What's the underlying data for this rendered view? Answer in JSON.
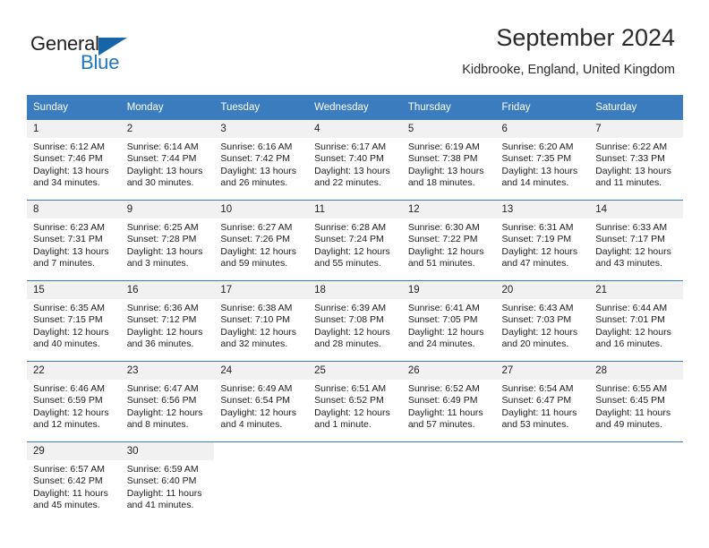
{
  "brand": {
    "name_top": "General",
    "name_bottom": "Blue",
    "colors": {
      "dark": "#231f20",
      "blue": "#1f77c4",
      "triangle": "#1565a8"
    }
  },
  "header": {
    "title": "September 2024",
    "location": "Kidbrooke, England, United Kingdom"
  },
  "theme": {
    "header_bg": "#3a7cbe",
    "daynum_bg": "#f1f1f1",
    "grid_line": "#3a7cbe"
  },
  "weekday_headers": [
    "Sunday",
    "Monday",
    "Tuesday",
    "Wednesday",
    "Thursday",
    "Friday",
    "Saturday"
  ],
  "weeks": [
    [
      {
        "day": "1",
        "sunrise": "Sunrise: 6:12 AM",
        "sunset": "Sunset: 7:46 PM",
        "daylight_1": "Daylight: 13 hours",
        "daylight_2": "and 34 minutes."
      },
      {
        "day": "2",
        "sunrise": "Sunrise: 6:14 AM",
        "sunset": "Sunset: 7:44 PM",
        "daylight_1": "Daylight: 13 hours",
        "daylight_2": "and 30 minutes."
      },
      {
        "day": "3",
        "sunrise": "Sunrise: 6:16 AM",
        "sunset": "Sunset: 7:42 PM",
        "daylight_1": "Daylight: 13 hours",
        "daylight_2": "and 26 minutes."
      },
      {
        "day": "4",
        "sunrise": "Sunrise: 6:17 AM",
        "sunset": "Sunset: 7:40 PM",
        "daylight_1": "Daylight: 13 hours",
        "daylight_2": "and 22 minutes."
      },
      {
        "day": "5",
        "sunrise": "Sunrise: 6:19 AM",
        "sunset": "Sunset: 7:38 PM",
        "daylight_1": "Daylight: 13 hours",
        "daylight_2": "and 18 minutes."
      },
      {
        "day": "6",
        "sunrise": "Sunrise: 6:20 AM",
        "sunset": "Sunset: 7:35 PM",
        "daylight_1": "Daylight: 13 hours",
        "daylight_2": "and 14 minutes."
      },
      {
        "day": "7",
        "sunrise": "Sunrise: 6:22 AM",
        "sunset": "Sunset: 7:33 PM",
        "daylight_1": "Daylight: 13 hours",
        "daylight_2": "and 11 minutes."
      }
    ],
    [
      {
        "day": "8",
        "sunrise": "Sunrise: 6:23 AM",
        "sunset": "Sunset: 7:31 PM",
        "daylight_1": "Daylight: 13 hours",
        "daylight_2": "and 7 minutes."
      },
      {
        "day": "9",
        "sunrise": "Sunrise: 6:25 AM",
        "sunset": "Sunset: 7:28 PM",
        "daylight_1": "Daylight: 13 hours",
        "daylight_2": "and 3 minutes."
      },
      {
        "day": "10",
        "sunrise": "Sunrise: 6:27 AM",
        "sunset": "Sunset: 7:26 PM",
        "daylight_1": "Daylight: 12 hours",
        "daylight_2": "and 59 minutes."
      },
      {
        "day": "11",
        "sunrise": "Sunrise: 6:28 AM",
        "sunset": "Sunset: 7:24 PM",
        "daylight_1": "Daylight: 12 hours",
        "daylight_2": "and 55 minutes."
      },
      {
        "day": "12",
        "sunrise": "Sunrise: 6:30 AM",
        "sunset": "Sunset: 7:22 PM",
        "daylight_1": "Daylight: 12 hours",
        "daylight_2": "and 51 minutes."
      },
      {
        "day": "13",
        "sunrise": "Sunrise: 6:31 AM",
        "sunset": "Sunset: 7:19 PM",
        "daylight_1": "Daylight: 12 hours",
        "daylight_2": "and 47 minutes."
      },
      {
        "day": "14",
        "sunrise": "Sunrise: 6:33 AM",
        "sunset": "Sunset: 7:17 PM",
        "daylight_1": "Daylight: 12 hours",
        "daylight_2": "and 43 minutes."
      }
    ],
    [
      {
        "day": "15",
        "sunrise": "Sunrise: 6:35 AM",
        "sunset": "Sunset: 7:15 PM",
        "daylight_1": "Daylight: 12 hours",
        "daylight_2": "and 40 minutes."
      },
      {
        "day": "16",
        "sunrise": "Sunrise: 6:36 AM",
        "sunset": "Sunset: 7:12 PM",
        "daylight_1": "Daylight: 12 hours",
        "daylight_2": "and 36 minutes."
      },
      {
        "day": "17",
        "sunrise": "Sunrise: 6:38 AM",
        "sunset": "Sunset: 7:10 PM",
        "daylight_1": "Daylight: 12 hours",
        "daylight_2": "and 32 minutes."
      },
      {
        "day": "18",
        "sunrise": "Sunrise: 6:39 AM",
        "sunset": "Sunset: 7:08 PM",
        "daylight_1": "Daylight: 12 hours",
        "daylight_2": "and 28 minutes."
      },
      {
        "day": "19",
        "sunrise": "Sunrise: 6:41 AM",
        "sunset": "Sunset: 7:05 PM",
        "daylight_1": "Daylight: 12 hours",
        "daylight_2": "and 24 minutes."
      },
      {
        "day": "20",
        "sunrise": "Sunrise: 6:43 AM",
        "sunset": "Sunset: 7:03 PM",
        "daylight_1": "Daylight: 12 hours",
        "daylight_2": "and 20 minutes."
      },
      {
        "day": "21",
        "sunrise": "Sunrise: 6:44 AM",
        "sunset": "Sunset: 7:01 PM",
        "daylight_1": "Daylight: 12 hours",
        "daylight_2": "and 16 minutes."
      }
    ],
    [
      {
        "day": "22",
        "sunrise": "Sunrise: 6:46 AM",
        "sunset": "Sunset: 6:59 PM",
        "daylight_1": "Daylight: 12 hours",
        "daylight_2": "and 12 minutes."
      },
      {
        "day": "23",
        "sunrise": "Sunrise: 6:47 AM",
        "sunset": "Sunset: 6:56 PM",
        "daylight_1": "Daylight: 12 hours",
        "daylight_2": "and 8 minutes."
      },
      {
        "day": "24",
        "sunrise": "Sunrise: 6:49 AM",
        "sunset": "Sunset: 6:54 PM",
        "daylight_1": "Daylight: 12 hours",
        "daylight_2": "and 4 minutes."
      },
      {
        "day": "25",
        "sunrise": "Sunrise: 6:51 AM",
        "sunset": "Sunset: 6:52 PM",
        "daylight_1": "Daylight: 12 hours",
        "daylight_2": "and 1 minute."
      },
      {
        "day": "26",
        "sunrise": "Sunrise: 6:52 AM",
        "sunset": "Sunset: 6:49 PM",
        "daylight_1": "Daylight: 11 hours",
        "daylight_2": "and 57 minutes."
      },
      {
        "day": "27",
        "sunrise": "Sunrise: 6:54 AM",
        "sunset": "Sunset: 6:47 PM",
        "daylight_1": "Daylight: 11 hours",
        "daylight_2": "and 53 minutes."
      },
      {
        "day": "28",
        "sunrise": "Sunrise: 6:55 AM",
        "sunset": "Sunset: 6:45 PM",
        "daylight_1": "Daylight: 11 hours",
        "daylight_2": "and 49 minutes."
      }
    ],
    [
      {
        "day": "29",
        "sunrise": "Sunrise: 6:57 AM",
        "sunset": "Sunset: 6:42 PM",
        "daylight_1": "Daylight: 11 hours",
        "daylight_2": "and 45 minutes."
      },
      {
        "day": "30",
        "sunrise": "Sunrise: 6:59 AM",
        "sunset": "Sunset: 6:40 PM",
        "daylight_1": "Daylight: 11 hours",
        "daylight_2": "and 41 minutes."
      },
      {
        "day": "",
        "sunrise": "",
        "sunset": "",
        "daylight_1": "",
        "daylight_2": ""
      },
      {
        "day": "",
        "sunrise": "",
        "sunset": "",
        "daylight_1": "",
        "daylight_2": ""
      },
      {
        "day": "",
        "sunrise": "",
        "sunset": "",
        "daylight_1": "",
        "daylight_2": ""
      },
      {
        "day": "",
        "sunrise": "",
        "sunset": "",
        "daylight_1": "",
        "daylight_2": ""
      },
      {
        "day": "",
        "sunrise": "",
        "sunset": "",
        "daylight_1": "",
        "daylight_2": ""
      }
    ]
  ]
}
